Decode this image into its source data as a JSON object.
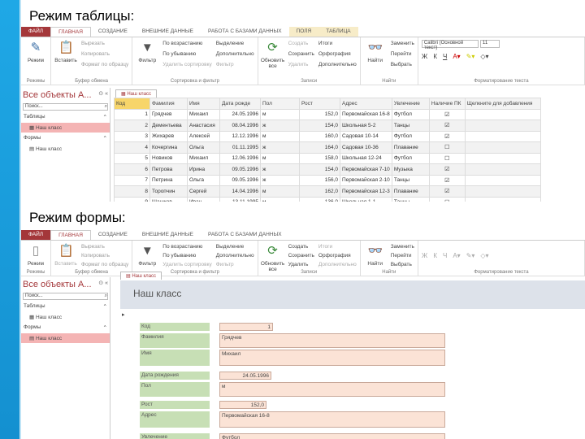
{
  "slide": {
    "title_table": "Режим таблицы:",
    "title_form": "Режим формы:"
  },
  "shot1": {
    "tabs": [
      "ФАЙЛ",
      "ГЛАВНАЯ",
      "СОЗДАНИЕ",
      "ВНЕШНИЕ ДАННЫЕ",
      "РАБОТА С БАЗАМИ ДАННЫХ",
      "ПОЛЯ",
      "ТАБЛИЦА"
    ],
    "ribbon": {
      "views": {
        "label": "Режим",
        "group": "Режимы"
      },
      "clipboard": {
        "paste": "Вставить",
        "cut": "Вырезать",
        "copy": "Копировать",
        "format": "Формат по образцу",
        "group": "Буфер обмена"
      },
      "sort": {
        "filter": "Фильтр",
        "asc": "По возрастанию",
        "desc": "По убыванию",
        "remove": "Удалить сортировку",
        "selection": "Выделение",
        "advanced": "Дополнительно",
        "toggle": "Фильтр",
        "group": "Сортировка и фильтр"
      },
      "records": {
        "refresh": "Обновить все",
        "new": "Создать",
        "save": "Сохранить",
        "delete": "Удалить",
        "totals": "Итоги",
        "spelling": "Орфография",
        "more": "Дополнительно",
        "group": "Записи"
      },
      "find": {
        "find": "Найти",
        "replace": "Заменить",
        "goto": "Перейти",
        "select": "Выбрать",
        "group": "Найти"
      },
      "format": {
        "font": "Calibri (Основной текст)",
        "size": "11",
        "bold": "Ж",
        "italic": "К",
        "underline": "Ч",
        "group": "Форматирование текста"
      }
    },
    "nav": {
      "title": "Все объекты А...",
      "search": "Поиск...",
      "sections": [
        {
          "label": "Таблицы",
          "items": [
            "Наш класс"
          ]
        },
        {
          "label": "Формы",
          "items": [
            "Наш класс"
          ]
        }
      ]
    },
    "doc_tab": "Наш класс",
    "columns": [
      "Код",
      "Фамилия",
      "Имя",
      "Дата рожде",
      "Пол",
      "Рост",
      "Адрес",
      "Увлечение",
      "Наличие ПК",
      "Щелкните для добавления"
    ],
    "rows": [
      [
        "1",
        "Грядчев",
        "Михаил",
        "24.05.1996",
        "м",
        "152,0",
        "Первомайская 16-8",
        "Футбол",
        true
      ],
      [
        "2",
        "Дементьева",
        "Анастасия",
        "08.04.1996",
        "ж",
        "154,0",
        "Школьная 5-2",
        "Танцы",
        true
      ],
      [
        "3",
        "Жихарев",
        "Алексей",
        "12.12.1996",
        "м",
        "160,0",
        "Садовая 10-14",
        "Футбол",
        true
      ],
      [
        "4",
        "Кочергина",
        "Ольга",
        "01.11.1995",
        "ж",
        "164,0",
        "Садовая 10-36",
        "Плавание",
        false
      ],
      [
        "5",
        "Новиков",
        "Михаил",
        "12.06.1996",
        "м",
        "158,0",
        "Школьная 12-24",
        "Футбол",
        false
      ],
      [
        "6",
        "Петрова",
        "Ирина",
        "09.05.1996",
        "ж",
        "154,0",
        "Первомайская 7-10",
        "Музыка",
        true
      ],
      [
        "7",
        "Петрина",
        "Ольга",
        "09.05.1996",
        "ж",
        "156,0",
        "Первомайская 2-10",
        "Танцы",
        true
      ],
      [
        "8",
        "Торопчин",
        "Сергей",
        "14.04.1996",
        "м",
        "162,0",
        "Первомайская 12-3",
        "Плавание",
        true
      ],
      [
        "9",
        "Шашков",
        "Иван",
        "13.11.1995",
        "м",
        "136,0",
        "Школьная 1-1",
        "Танцы",
        false
      ]
    ]
  },
  "shot2": {
    "tabs": [
      "ФАЙЛ",
      "ГЛАВНАЯ",
      "СОЗДАНИЕ",
      "ВНЕШНИЕ ДАННЫЕ",
      "РАБОТА С БАЗАМИ ДАННЫХ"
    ],
    "ribbon": {
      "views": {
        "label": "Режим",
        "group": "Режимы"
      },
      "clipboard": {
        "paste": "Вставить",
        "cut": "Вырезать",
        "copy": "Копировать",
        "format": "Формат по образцу",
        "group": "Буфер обмена"
      },
      "sort": {
        "filter": "Фильтр",
        "asc": "По возрастанию",
        "desc": "По убыванию",
        "remove": "Удалить сортировку",
        "selection": "Выделение",
        "advanced": "Дополнительно",
        "toggle": "Фильтр",
        "group": "Сортировка и фильтр"
      },
      "records": {
        "refresh": "Обновить все",
        "new": "Создать",
        "save": "Сохранить",
        "delete": "Удалить",
        "totals": "Итоги",
        "spelling": "Орфография",
        "more": "Дополнительно",
        "group": "Записи"
      },
      "find": {
        "find": "Найти",
        "replace": "Заменить",
        "goto": "Перейти",
        "select": "Выбрать",
        "group": "Найти"
      },
      "format": {
        "bold": "Ж",
        "italic": "К",
        "underline": "Ч",
        "group": "Форматирование текста"
      }
    },
    "nav": {
      "title": "Все объекты А...",
      "search": "Поиск...",
      "sections": [
        {
          "label": "Таблицы",
          "items": [
            "Наш класс"
          ]
        },
        {
          "label": "Формы",
          "items": [
            "Наш класс"
          ]
        }
      ]
    },
    "doc_tab": "Наш класс",
    "form_title": "Наш класс",
    "fields": [
      {
        "label": "Код",
        "value": "1"
      },
      {
        "label": "Фамилия",
        "value": "Грядчев"
      },
      {
        "label": "Имя",
        "value": "Михаил"
      },
      {
        "label": "Дата рождения",
        "value": "24.05.1996"
      },
      {
        "label": "Пол",
        "value": "м"
      },
      {
        "label": "Рост",
        "value": "152,0"
      },
      {
        "label": "Адрес",
        "value": "Первомайская 16-8"
      },
      {
        "label": "Увлечение",
        "value": "Футбол"
      }
    ]
  }
}
